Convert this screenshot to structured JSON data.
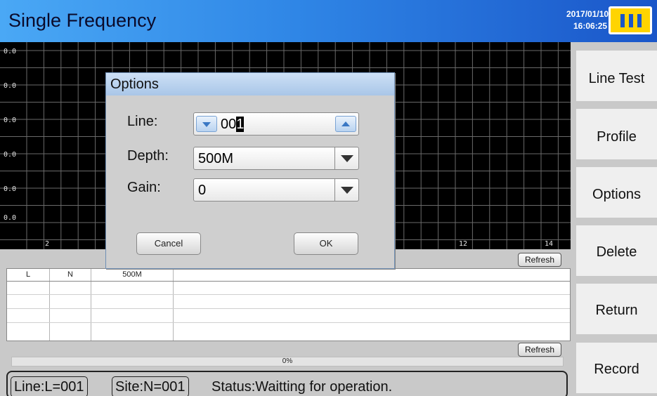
{
  "header": {
    "title": "Single Frequency",
    "date": "2017/01/10",
    "time": "16:06:25",
    "battery_icon": "battery-full-icon"
  },
  "chart": {
    "y_labels": [
      "0.0",
      "0.0",
      "0.0",
      "0.0",
      "0.0",
      "0.0"
    ],
    "x_labels": [
      "2",
      "12",
      "14"
    ],
    "refresh_label": "Refresh"
  },
  "table": {
    "headers": [
      "L",
      "N",
      "500M"
    ],
    "refresh_label": "Refresh"
  },
  "progress": {
    "text": "0%",
    "value": 0
  },
  "status": {
    "line": "Line:L=001",
    "site": "Site:N=001",
    "status": "Status:Waitting for operation."
  },
  "menu": {
    "items": [
      "Line Test",
      "Profile",
      "Options",
      "Delete",
      "Return",
      "Record"
    ]
  },
  "dialog": {
    "title": "Options",
    "line_label": "Line:",
    "line_value": "00",
    "line_cursor": "1",
    "depth_label": "Depth:",
    "depth_value": "500M",
    "gain_label": "Gain:",
    "gain_value": "0",
    "cancel_label": "Cancel",
    "ok_label": "OK"
  },
  "colors": {
    "title_bar_start": "#4aa8f5",
    "title_bar_end": "#1a56c9",
    "battery": "#ffd400",
    "chart_bg": "#000000"
  }
}
